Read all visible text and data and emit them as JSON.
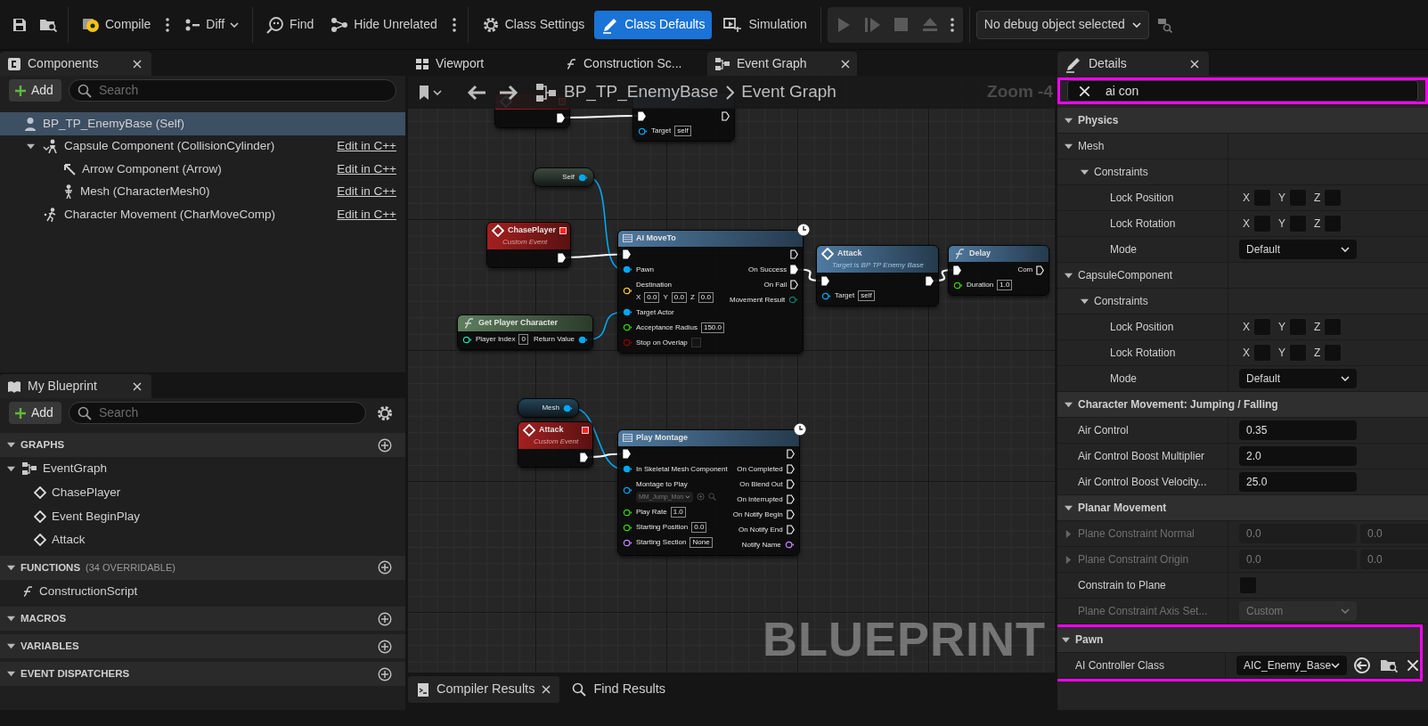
{
  "toolbar": {
    "buttons": [
      {
        "label": "Compile",
        "selected": false,
        "more": true,
        "caret": false
      },
      {
        "label": "Diff",
        "selected": false,
        "more": false,
        "caret": true
      },
      {
        "label": "Find",
        "selected": false,
        "more": false,
        "caret": false
      },
      {
        "label": "Hide Unrelated",
        "selected": false,
        "more": true,
        "caret": false
      },
      {
        "label": "Class Settings",
        "selected": false,
        "more": false,
        "caret": false
      },
      {
        "label": "Class Defaults",
        "selected": true,
        "more": false,
        "caret": false
      },
      {
        "label": "Simulation",
        "selected": false,
        "more": false,
        "caret": false
      }
    ],
    "play_controls": {
      "disabled": true
    },
    "debug_object": "No debug object selected"
  },
  "components": {
    "title": "Components",
    "add_label": "Add",
    "search_placeholder": "Search",
    "tree": [
      {
        "label": "BP_TP_EnemyBase (Self)",
        "kind": "self",
        "selected": true,
        "children": [
          {
            "label": "Capsule Component (CollisionCylinder)",
            "kind": "capsule",
            "selected": false,
            "expanded": true,
            "link": "Edit in C++",
            "children": [
              {
                "label": "Arrow Component (Arrow)",
                "kind": "arrow",
                "selected": false,
                "link": "Edit in C++"
              },
              {
                "label": "Mesh (CharacterMesh0)",
                "kind": "mesh",
                "selected": false,
                "link": "Edit in C++"
              }
            ]
          },
          {
            "label": "Character Movement (CharMoveComp)",
            "kind": "movement",
            "selected": false,
            "link": "Edit in C++"
          }
        ]
      }
    ]
  },
  "my_blueprint": {
    "title": "My Blueprint",
    "add_label": "Add",
    "search_placeholder": "Search",
    "sections": [
      {
        "title": "GRAPHS",
        "items": [
          {
            "label": "EventGraph",
            "kind": "graph",
            "expanded": true,
            "children": [
              {
                "label": "ChasePlayer",
                "kind": "event"
              },
              {
                "label": "Event BeginPlay",
                "kind": "event"
              },
              {
                "label": "Attack",
                "kind": "event"
              }
            ]
          }
        ]
      },
      {
        "title": "FUNCTIONS",
        "note": "(34 OVERRIDABLE)",
        "items": [
          {
            "label": "ConstructionScript",
            "kind": "function"
          }
        ]
      },
      {
        "title": "MACROS"
      },
      {
        "title": "VARIABLES"
      },
      {
        "title": "EVENT DISPATCHERS"
      }
    ]
  },
  "editor_tabs": [
    {
      "label": "Viewport",
      "selected": false,
      "closable": false
    },
    {
      "label": "Construction Sc...",
      "selected": false,
      "closable": false
    },
    {
      "label": "Event Graph",
      "selected": true,
      "closable": true
    }
  ],
  "breadcrumb": {
    "path": [
      "BP_TP_EnemyBase",
      "Event Graph"
    ],
    "zoom": "Zoom -4"
  },
  "graph": {
    "watermark": "BLUEPRINT",
    "nodes": [
      {
        "kind": "event",
        "outputs": [
          {
            "kind": "exec",
            "connected": true
          }
        ]
      },
      {
        "kind": "function",
        "inputs": [
          {
            "kind": "exec",
            "connected": true
          },
          {
            "kind": "object",
            "label": "Target",
            "value": "self",
            "connected": false
          }
        ],
        "outputs": [
          {
            "kind": "exec",
            "connected": false
          }
        ]
      },
      {
        "kind": "getter",
        "outputs": [
          {
            "kind": "object",
            "label": "Self",
            "connected": true
          }
        ]
      },
      {
        "kind": "event",
        "title": "ChasePlayer",
        "subtitle": "Custom Event",
        "outputs": [
          {
            "kind": "exec",
            "connected": true
          }
        ]
      },
      {
        "kind": "latent",
        "title": "AI MoveTo",
        "inputs": [
          {
            "kind": "exec",
            "connected": true
          },
          {
            "kind": "object",
            "label": "Pawn",
            "connected": true
          },
          {
            "kind": "vector",
            "label": "Destination",
            "connected": false,
            "values": [
              {
                "axis": "X",
                "value": "0.0"
              },
              {
                "axis": "Y",
                "value": "0.0"
              },
              {
                "axis": "Z",
                "value": "0.0"
              }
            ]
          },
          {
            "kind": "object",
            "label": "Target Actor",
            "connected": true
          },
          {
            "kind": "float",
            "label": "Acceptance Radius",
            "value": "150.0",
            "connected": false
          },
          {
            "kind": "bool",
            "label": "Stop on Overlap",
            "connected": false,
            "checked": false
          }
        ],
        "outputs": [
          {
            "kind": "exec",
            "connected": false
          },
          {
            "kind": "exec",
            "label": "On Success",
            "connected": true
          },
          {
            "kind": "exec",
            "label": "On Fail",
            "connected": false
          },
          {
            "kind": "enum",
            "label": "Movement Result",
            "connected": false
          }
        ]
      },
      {
        "kind": "call",
        "title": "Attack",
        "subtitle": "Target is BP TP Enemy Base",
        "inputs": [
          {
            "kind": "exec",
            "connected": true
          },
          {
            "kind": "object",
            "label": "Target",
            "value": "self",
            "connected": false
          }
        ],
        "outputs": [
          {
            "kind": "exec",
            "connected": true
          }
        ]
      },
      {
        "kind": "function",
        "title": "Delay",
        "inputs": [
          {
            "kind": "exec",
            "connected": true
          },
          {
            "kind": "float",
            "label": "Duration",
            "value": "1.0",
            "connected": false
          }
        ],
        "outputs": [
          {
            "kind": "exec",
            "label": "Com",
            "connected": false
          }
        ]
      },
      {
        "kind": "pure",
        "title": "Get Player Character",
        "inputs": [
          {
            "kind": "int",
            "label": "Player Index",
            "value": "0",
            "connected": false
          }
        ],
        "outputs": [
          {
            "kind": "object",
            "label": "Return Value",
            "connected": true
          }
        ]
      },
      {
        "kind": "getter",
        "outputs": [
          {
            "kind": "object",
            "label": "Mesh",
            "connected": true
          }
        ]
      },
      {
        "kind": "event",
        "title": "Attack",
        "subtitle": "Custom Event",
        "outputs": [
          {
            "kind": "exec",
            "connected": true
          }
        ]
      },
      {
        "kind": "latent",
        "title": "Play Montage",
        "inputs": [
          {
            "kind": "exec",
            "connected": true
          },
          {
            "kind": "object",
            "label": "In Skeletal Mesh Component",
            "connected": true
          },
          {
            "kind": "asset",
            "label": "Montage to Play",
            "value": "MM_Jump_Mon",
            "connected": false
          },
          {
            "kind": "float",
            "label": "Play Rate",
            "value": "1.0",
            "connected": false
          },
          {
            "kind": "float",
            "label": "Starting Position",
            "value": "0.0",
            "connected": false
          },
          {
            "kind": "name",
            "label": "Starting Section",
            "value": "None",
            "connected": false
          }
        ],
        "outputs": [
          {
            "kind": "exec",
            "connected": false
          },
          {
            "kind": "exec",
            "label": "On Completed",
            "connected": false
          },
          {
            "kind": "exec",
            "label": "On Blend Out",
            "connected": false
          },
          {
            "kind": "exec",
            "label": "On Interrupted",
            "connected": false
          },
          {
            "kind": "exec",
            "label": "On Notify Begin",
            "connected": false
          },
          {
            "kind": "exec",
            "label": "On Notify End",
            "connected": false
          },
          {
            "kind": "name",
            "label": "Notify Name",
            "connected": false
          }
        ]
      }
    ]
  },
  "bottom_tabs": [
    {
      "label": "Compiler Results",
      "selected": true,
      "closable": true
    },
    {
      "label": "Find Results",
      "selected": false,
      "closable": false
    }
  ],
  "details": {
    "title": "Details",
    "search": {
      "value": "ai con",
      "highlighted": true
    },
    "rows": [
      {
        "kind": "category",
        "label": "Physics",
        "expanded": true,
        "children": [
          {
            "kind": "group",
            "label": "Mesh",
            "expanded": true,
            "children": [
              {
                "kind": "group",
                "label": "Constraints",
                "expanded": true,
                "children": [
                  {
                    "kind": "checks",
                    "label": "Lock Position",
                    "axes": [
                      {
                        "label": "X",
                        "checked": false
                      },
                      {
                        "label": "Y",
                        "checked": false
                      },
                      {
                        "label": "Z",
                        "checked": false
                      }
                    ]
                  },
                  {
                    "kind": "checks",
                    "label": "Lock Rotation",
                    "axes": [
                      {
                        "label": "X",
                        "checked": false
                      },
                      {
                        "label": "Y",
                        "checked": false
                      },
                      {
                        "label": "Z",
                        "checked": false
                      }
                    ]
                  },
                  {
                    "kind": "dropdown",
                    "label": "Mode",
                    "value": "Default"
                  }
                ]
              }
            ]
          },
          {
            "kind": "group",
            "label": "CapsuleComponent",
            "expanded": true,
            "children": [
              {
                "kind": "group",
                "label": "Constraints",
                "expanded": true,
                "children": [
                  {
                    "kind": "checks",
                    "label": "Lock Position",
                    "axes": [
                      {
                        "label": "X",
                        "checked": false
                      },
                      {
                        "label": "Y",
                        "checked": false
                      },
                      {
                        "label": "Z",
                        "checked": false
                      }
                    ]
                  },
                  {
                    "kind": "checks",
                    "label": "Lock Rotation",
                    "axes": [
                      {
                        "label": "X",
                        "checked": false
                      },
                      {
                        "label": "Y",
                        "checked": false
                      },
                      {
                        "label": "Z",
                        "checked": false
                      }
                    ]
                  },
                  {
                    "kind": "dropdown",
                    "label": "Mode",
                    "value": "Default"
                  }
                ]
              }
            ]
          }
        ]
      },
      {
        "kind": "category",
        "label": "Character Movement: Jumping / Falling",
        "expanded": true,
        "children": [
          {
            "kind": "number",
            "label": "Air Control",
            "value": "0.35"
          },
          {
            "kind": "number",
            "label": "Air Control Boost Multiplier",
            "value": "2.0"
          },
          {
            "kind": "number",
            "label": "Air Control Boost Velocity...",
            "value": "25.0"
          }
        ]
      },
      {
        "kind": "category",
        "label": "Planar Movement",
        "expanded": true,
        "children": [
          {
            "kind": "vector2",
            "label": "Plane Constraint Normal",
            "expanded": false,
            "disabled": true,
            "values": [
              "0.0",
              "0.0"
            ]
          },
          {
            "kind": "vector2",
            "label": "Plane Constraint Origin",
            "expanded": false,
            "disabled": true,
            "values": [
              "0.0",
              "0.0"
            ]
          },
          {
            "kind": "checkbox",
            "label": "Constrain to Plane",
            "disabled": false,
            "checked": false
          },
          {
            "kind": "dropdown",
            "label": "Plane Constraint Axis Set...",
            "disabled": true,
            "value": "Custom"
          }
        ]
      },
      {
        "kind": "category",
        "label": "Pawn",
        "expanded": true,
        "highlighted": true,
        "children": [
          {
            "kind": "class",
            "label": "AI Controller Class",
            "value": "AIC_Enemy_Base"
          }
        ]
      }
    ]
  }
}
